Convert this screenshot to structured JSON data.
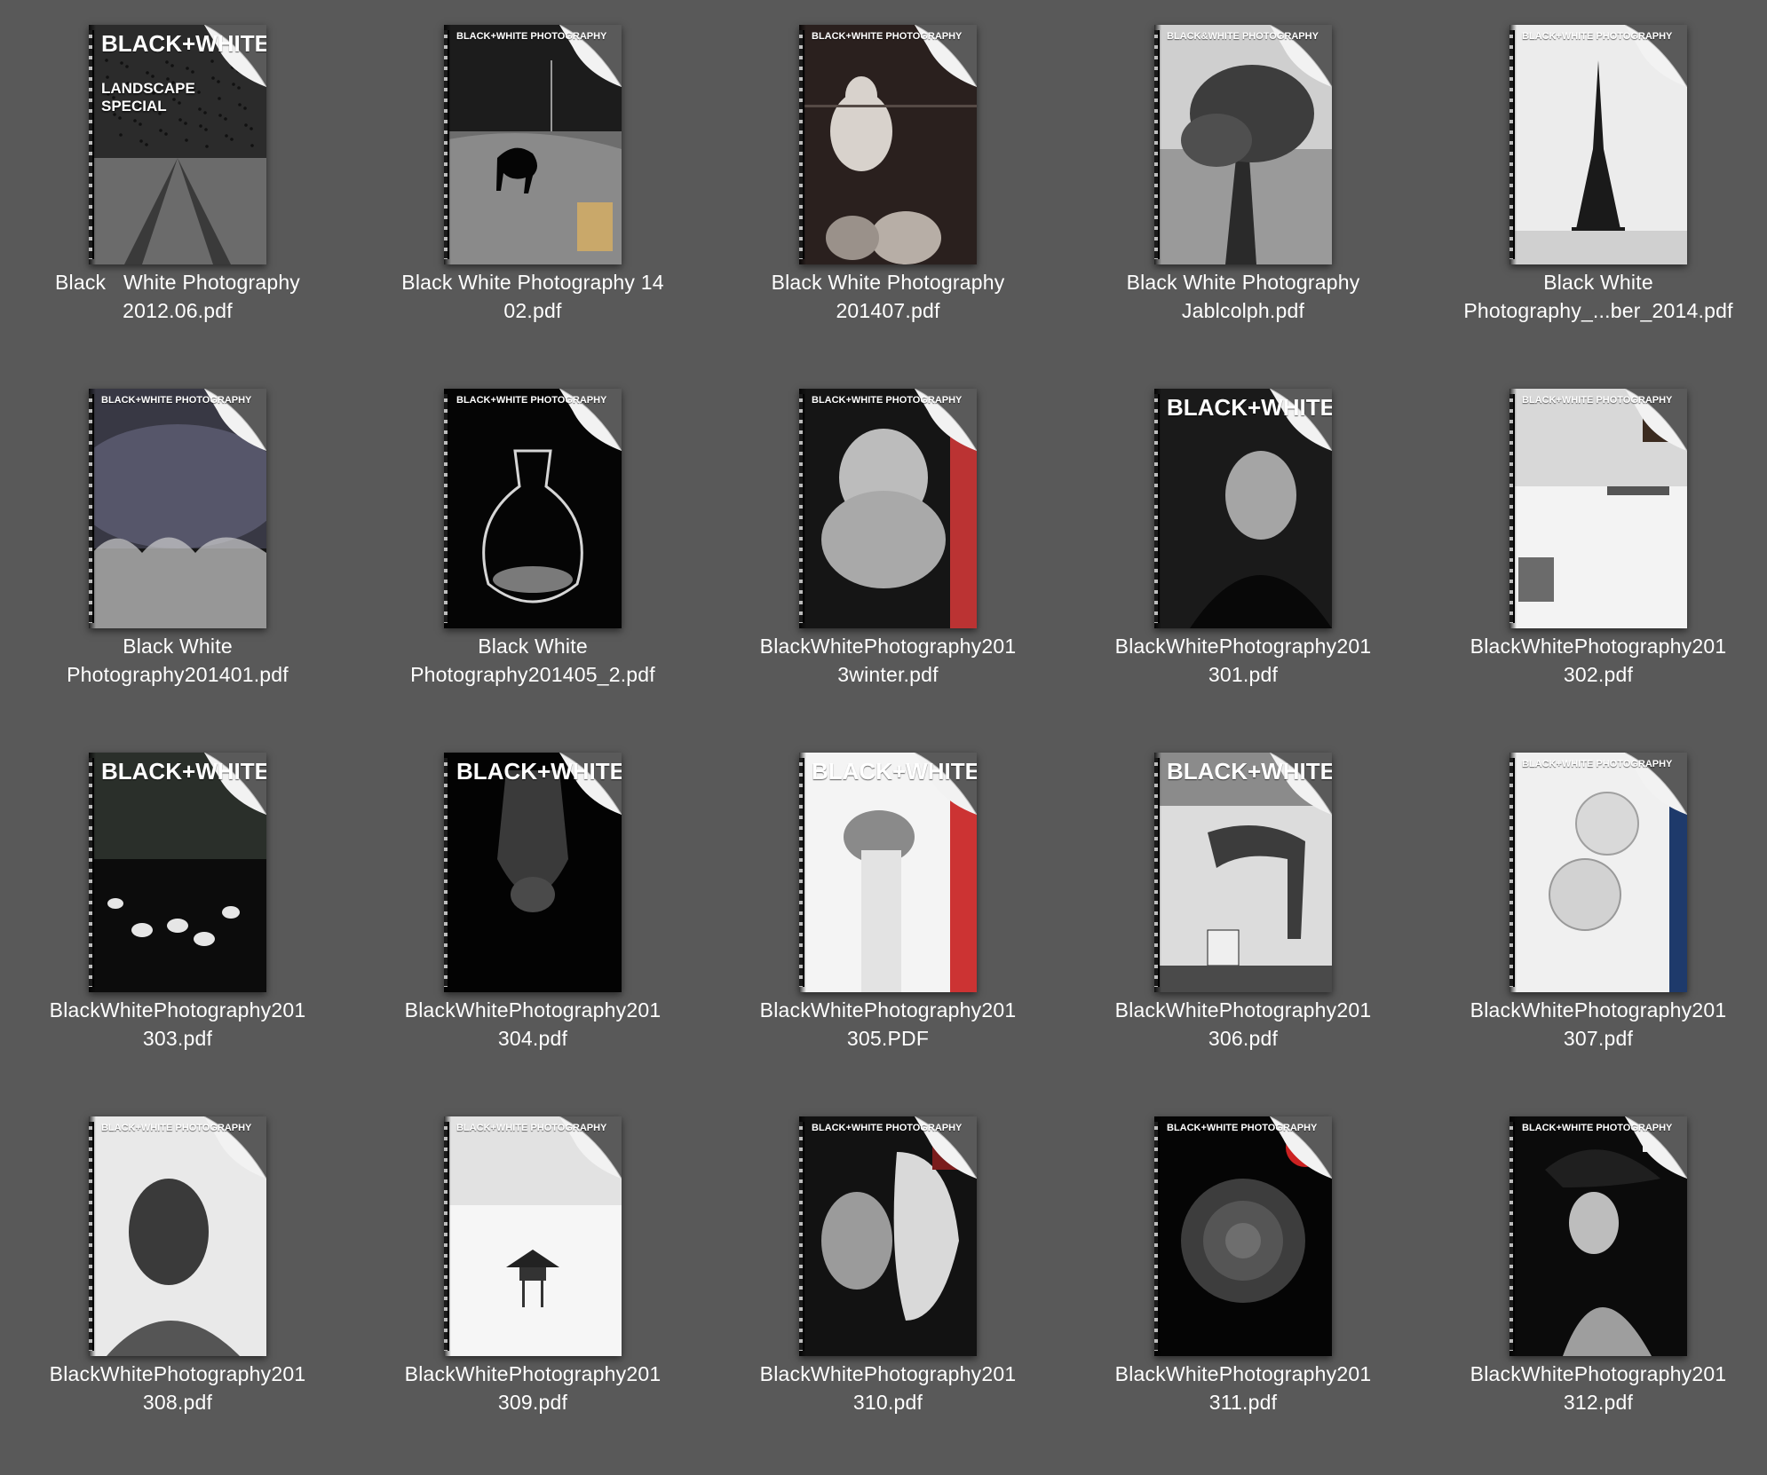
{
  "window": {
    "background": "#595959"
  },
  "files": [
    {
      "line1": "Black   White Photography",
      "line2": "2012.06.pdf",
      "masthead": "BLACK+WHITE",
      "cover": "landscape-birds",
      "cover_text": [
        "LANDSCAPE",
        "SPECIAL"
      ]
    },
    {
      "line1": "Black White Photography 14",
      "line2": "02.pdf",
      "masthead": "BLACK+WHITE PHOTOGRAPHY",
      "cover": "dog-windmill"
    },
    {
      "line1": "Black White Photography",
      "line2": "201407.pdf",
      "masthead": "BLACK+WHITE PHOTOGRAPHY",
      "cover": "pears"
    },
    {
      "line1": "Black White Photography",
      "line2": "Jablcolph.pdf",
      "masthead": "BLACK&WHITE PHOTOGRAPHY",
      "cover": "tree-river"
    },
    {
      "line1": "Black White",
      "line2": "Photography_...ber_2014.pdf",
      "masthead": "BLACK+WHITE PHOTOGRAPHY",
      "cover": "eiffel"
    },
    {
      "line1": "Black White",
      "line2": "Photography201401.pdf",
      "masthead": "BLACK+WHITE PHOTOGRAPHY",
      "cover": "trees-dark"
    },
    {
      "line1": "Black White",
      "line2": "Photography201405_2.pdf",
      "masthead": "BLACK+WHITE PHOTOGRAPHY",
      "cover": "vase"
    },
    {
      "line1": "BlackWhitePhotography201",
      "line2": "3winter.pdf",
      "masthead": "BLACK+WHITE PHOTOGRAPHY",
      "cover": "man-hands"
    },
    {
      "line1": "BlackWhitePhotography201",
      "line2": "301.pdf",
      "masthead": "BLACK+WHITE",
      "cover": "portrait-man"
    },
    {
      "line1": "BlackWhitePhotography201",
      "line2": "302.pdf",
      "masthead": "BLACK+WHITE PHOTOGRAPHY",
      "cover": "snow-white"
    },
    {
      "line1": "BlackWhitePhotography201",
      "line2": "303.pdf",
      "masthead": "BLACK+WHITE",
      "cover": "flamingos"
    },
    {
      "line1": "BlackWhitePhotography201",
      "line2": "304.pdf",
      "masthead": "BLACK+WHITE",
      "cover": "bat"
    },
    {
      "line1": "BlackWhitePhotography201",
      "line2": "305.PDF",
      "masthead": "BLACK+WHITE",
      "cover": "dog-white"
    },
    {
      "line1": "BlackWhitePhotography201",
      "line2": "306.pdf",
      "masthead": "BLACK+WHITE",
      "cover": "legs-shoe"
    },
    {
      "line1": "BlackWhitePhotography201",
      "line2": "307.pdf",
      "masthead": "BLACK+WHITE PHOTOGRAPHY",
      "cover": "roses"
    },
    {
      "line1": "BlackWhitePhotography201",
      "line2": "308.pdf",
      "masthead": "BLACK+WHITE PHOTOGRAPHY",
      "cover": "woman-face"
    },
    {
      "line1": "BlackWhitePhotography201",
      "line2": "309.pdf",
      "masthead": "BLACK+WHITE PHOTOGRAPHY",
      "cover": "lifeguard"
    },
    {
      "line1": "BlackWhitePhotography201",
      "line2": "310.pdf",
      "masthead": "BLACK+WHITE PHOTOGRAPHY",
      "cover": "girl-horse"
    },
    {
      "line1": "BlackWhitePhotography201",
      "line2": "311.pdf",
      "masthead": "BLACK+WHITE PHOTOGRAPHY",
      "cover": "rose-dark"
    },
    {
      "line1": "BlackWhitePhotography201",
      "line2": "312.pdf",
      "masthead": "BLACK+WHITE PHOTOGRAPHY",
      "cover": "woman-hat"
    }
  ]
}
